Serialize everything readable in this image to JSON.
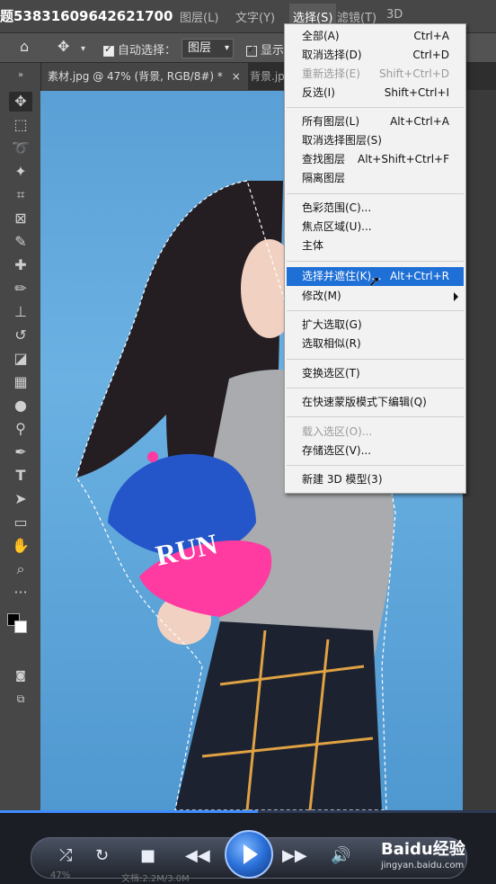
{
  "window": {
    "title": "题5383160964262170​0"
  },
  "menubar": {
    "items": [
      "图层(L)",
      "文字(Y)",
      "选择(S)",
      "滤镜(T)",
      "3D"
    ],
    "active": "选择(S)"
  },
  "options": {
    "auto_select_label": "自动选择：",
    "layer_value": "图层",
    "show_label": "显示"
  },
  "tabs": [
    {
      "label": "素材.jpg @ 47% (背景, RGB/8#) *",
      "close": "×"
    },
    {
      "label": "背景.jp"
    }
  ],
  "select_menu": {
    "items": [
      {
        "label": "全部(A)",
        "shortcut": "Ctrl+A"
      },
      {
        "label": "取消选择(D)",
        "shortcut": "Ctrl+D"
      },
      {
        "label": "重新选择(E)",
        "shortcut": "Shift+Ctrl+D",
        "disabled": true
      },
      {
        "label": "反选(I)",
        "shortcut": "Shift+Ctrl+I"
      },
      {
        "label": "所有图层(L)",
        "shortcut": "Alt+Ctrl+A"
      },
      {
        "label": "取消选择图层(S)",
        "shortcut": ""
      },
      {
        "label": "查找图层",
        "shortcut": "Alt+Shift+Ctrl+F"
      },
      {
        "label": "隔离图层",
        "shortcut": ""
      },
      {
        "label": "色彩范围(C)...",
        "shortcut": ""
      },
      {
        "label": "焦点区域(U)...",
        "shortcut": ""
      },
      {
        "label": "主体",
        "shortcut": ""
      },
      {
        "label": "选择并遮住(K)...",
        "shortcut": "Alt+Ctrl+R",
        "selected": true
      },
      {
        "label": "修改(M)",
        "shortcut": "",
        "submenu": true
      },
      {
        "label": "扩大选取(G)",
        "shortcut": ""
      },
      {
        "label": "选取相似(R)",
        "shortcut": ""
      },
      {
        "label": "变换选区(T)",
        "shortcut": ""
      },
      {
        "label": "在快速蒙版模式下编辑(Q)",
        "shortcut": ""
      },
      {
        "label": "载入选区(O)...",
        "shortcut": "",
        "disabled": true
      },
      {
        "label": "存储选区(V)...",
        "shortcut": ""
      },
      {
        "label": "新建 3D 模型(3)",
        "shortcut": ""
      }
    ]
  },
  "canvas": {
    "cap_text": "RUN"
  },
  "player": {
    "progress_fraction": 0.52
  },
  "status": {
    "zoom": "47%",
    "doc": "文档:2.2M/3.0M"
  },
  "watermark": {
    "brand": "Baidu经验",
    "url": "jingyan.baidu.com"
  },
  "colors": {
    "canvas_bg": "#5aa0d6",
    "menu_highlight": "#1e6fd6",
    "cap_blue": "#2456c9",
    "cap_pink": "#ff3aa0"
  },
  "icons": [
    "home-icon",
    "move-icon",
    "marquee-icon",
    "lasso-icon",
    "magic-wand-icon",
    "crop-icon",
    "frame-icon",
    "eyedropper-icon",
    "healing-icon",
    "brush-icon",
    "stamp-icon",
    "history-brush-icon",
    "eraser-icon",
    "gradient-icon",
    "blur-icon",
    "dodge-icon",
    "pen-icon",
    "type-icon",
    "path-select-icon",
    "rectangle-icon",
    "hand-icon",
    "zoom-icon",
    "more-icon"
  ]
}
